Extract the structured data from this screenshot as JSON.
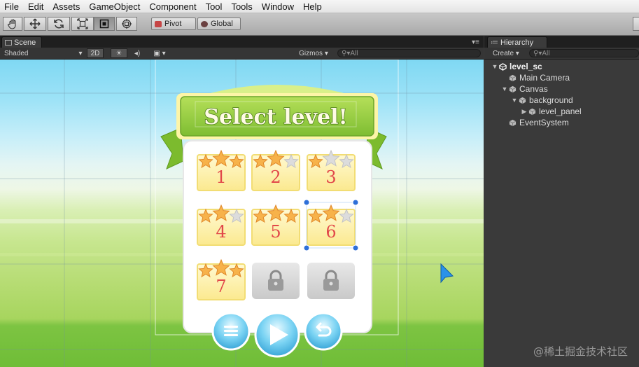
{
  "menu": [
    "File",
    "Edit",
    "Assets",
    "GameObject",
    "Component",
    "Tool",
    "Tools",
    "Window",
    "Help"
  ],
  "toolbar": {
    "tools": [
      "hand-tool",
      "move-tool",
      "rotate-tool",
      "scale-tool",
      "rect-tool",
      "transform-tool"
    ],
    "active_tool": "rect-tool",
    "pivot_label": "Pivot",
    "global_label": "Global"
  },
  "scene": {
    "tab_label": "Scene",
    "shading_mode": "Shaded",
    "mode_2d_label": "2D",
    "gizmos_label": "Gizmos",
    "search_placeholder": "All"
  },
  "game": {
    "title": "Select level!",
    "levels": [
      {
        "label": "1",
        "stars": 3,
        "locked": false
      },
      {
        "label": "2",
        "stars": 2,
        "locked": false
      },
      {
        "label": "3",
        "stars": 1,
        "locked": false
      },
      {
        "label": "4",
        "stars": 2,
        "locked": false
      },
      {
        "label": "5",
        "stars": 3,
        "locked": false
      },
      {
        "label": "6",
        "stars": 2,
        "locked": false
      },
      {
        "label": "7",
        "stars": 3,
        "locked": false
      },
      {
        "label": "",
        "stars": 0,
        "locked": true
      },
      {
        "label": "",
        "stars": 0,
        "locked": true
      }
    ],
    "bottom_buttons": [
      "menu-button",
      "play-button",
      "back-button"
    ]
  },
  "hierarchy": {
    "tab_label": "Hierarchy",
    "create_label": "Create",
    "search_placeholder": "All",
    "items": [
      {
        "label": "level_sc",
        "depth": 0,
        "expanded": true,
        "icon": "unity-icon",
        "bold": true
      },
      {
        "label": "Main Camera",
        "depth": 1,
        "icon": "cube-icon"
      },
      {
        "label": "Canvas",
        "depth": 1,
        "expanded": true,
        "icon": "cube-icon"
      },
      {
        "label": "background",
        "depth": 2,
        "expanded": true,
        "icon": "cube-icon"
      },
      {
        "label": "level_panel",
        "depth": 3,
        "expanded": false,
        "icon": "cube-icon"
      },
      {
        "label": "EventSystem",
        "depth": 1,
        "icon": "cube-icon"
      }
    ]
  },
  "watermark": "@稀土掘金技术社区",
  "colors": {
    "banner_green": "#8cc63f",
    "title_text": "#fffbe6",
    "tile_yellow": "#fff5b8",
    "digit_red": "#e2484a",
    "button_blue": "#5cc6ee",
    "handle_blue": "#2e6fd8"
  }
}
